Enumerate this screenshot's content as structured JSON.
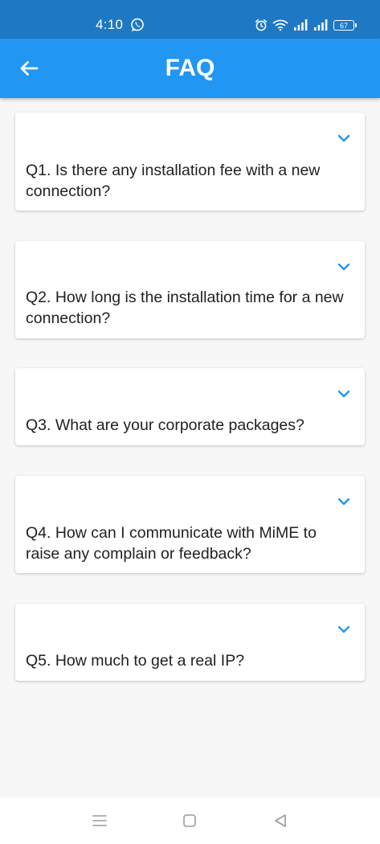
{
  "status_bar": {
    "time": "4:10",
    "battery": "67",
    "icons": [
      "whatsapp-icon",
      "alarm-icon",
      "wifi-icon",
      "signal-icon",
      "signal-icon",
      "battery-icon"
    ]
  },
  "app_bar": {
    "title": "FAQ",
    "back_icon": "arrow-left-icon",
    "color": "#2196f3"
  },
  "faqs": [
    {
      "question": "Q1. Is there any installation fee with a new connection?",
      "icon": "chevron-down-icon"
    },
    {
      "question": "Q2. How long is the installation time for a new connection?",
      "icon": "chevron-down-icon"
    },
    {
      "question": "Q3. What are your corporate packages?",
      "icon": "chevron-down-icon"
    },
    {
      "question": "Q4. How can I communicate with MiME to raise any complain or feedback?",
      "icon": "chevron-down-icon"
    },
    {
      "question": "Q5. How much to get a real IP?",
      "icon": "chevron-down-icon"
    }
  ],
  "nav_bar": {
    "icons": [
      "menu-icon",
      "home-square-icon",
      "back-triangle-icon"
    ]
  },
  "colors": {
    "status_bar": "#1e78c4",
    "accent": "#2196f3",
    "text": "#212121",
    "background": "#f7f7f7"
  }
}
